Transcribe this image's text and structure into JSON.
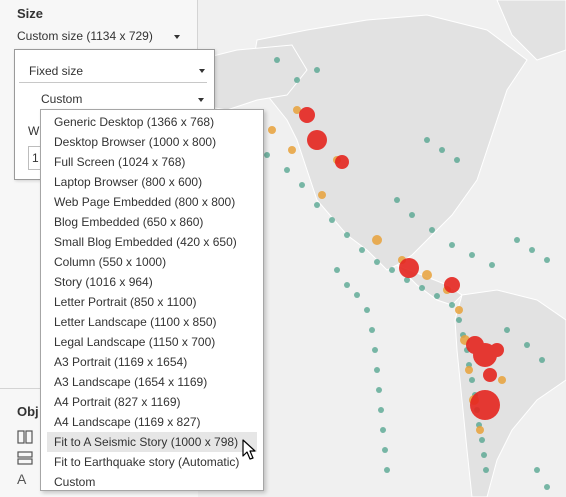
{
  "panel": {
    "title": "Size",
    "size_value": "Custom size (1134 x 729)",
    "fixed_value": "Fixed size",
    "custom_value": "Custom",
    "width_label_partial": "W",
    "width_value_partial": "1",
    "objects_title_partial": "Obj",
    "object_icons": [
      "horizontal-layout-icon",
      "vertical-layout-icon",
      "text-icon"
    ]
  },
  "dropdown": {
    "items": [
      "Generic Desktop (1366 x 768)",
      "Desktop Browser (1000 x 800)",
      "Full Screen (1024 x 768)",
      "Laptop Browser (800 x 600)",
      "Web Page Embedded (800 x 800)",
      "Blog Embedded (650 x 860)",
      "Small Blog Embedded (420 x 650)",
      "Column (550 x 1000)",
      "Story (1016 x 964)",
      "Letter Portrait (850 x 1100)",
      "Letter Landscape (1100 x 850)",
      "Legal Landscape (1150 x 700)",
      "A3 Portrait (1169 x 1654)",
      "A3 Landscape (1654 x 1169)",
      "A4 Portrait (827 x 1169)",
      "A4 Landscape (1169 x 827)",
      "Fit to A Seismic Story (1000 x 798)",
      "Fit to Earthquake story (Automatic)",
      "Custom"
    ],
    "hovered_index": 16
  },
  "map": {
    "land_color": "#e4e4e4",
    "ocean_color": "#f2f2f2",
    "colors": {
      "low": "#4fa38c",
      "mid": "#e8a23b",
      "high": "#e52620"
    }
  }
}
